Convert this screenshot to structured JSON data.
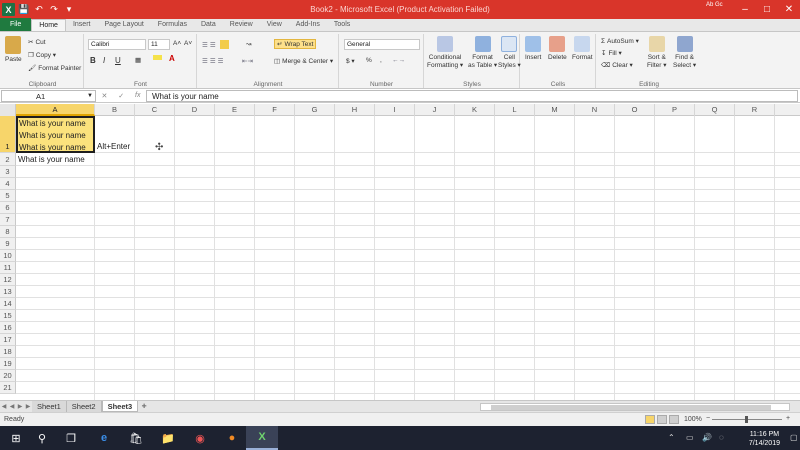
{
  "titlebar": {
    "title": "Book2 - Microsoft Excel (Product Activation Failed)",
    "account_text": "Ab Gc"
  },
  "ribbon_tabs": [
    "File",
    "Home",
    "Insert",
    "Page Layout",
    "Formulas",
    "Data",
    "Review",
    "View",
    "Add-Ins",
    "Tools"
  ],
  "active_tab": "Home",
  "clipboard": {
    "paste": "Paste",
    "cut": "Cut",
    "copy": "Copy ▾",
    "format_painter": "Format Painter",
    "label": "Clipboard"
  },
  "font": {
    "name": "Calibri",
    "size": "11",
    "bold": "B",
    "italic": "I",
    "underline": "U",
    "label": "Font",
    "grow": "A˄",
    "shrink": "A˅"
  },
  "alignment": {
    "wrap_text": "Wrap Text",
    "merge_center": "Merge & Center ▾",
    "label": "Alignment"
  },
  "number": {
    "format": "General",
    "currency": "$ ▾",
    "percent": "%",
    "comma": ",",
    "label": "Number"
  },
  "styles": {
    "conditional": "Conditional\nFormatting ▾",
    "format_table": "Format\nas Table ▾",
    "cell_styles": "Cell\nStyles ▾",
    "label": "Styles"
  },
  "cells": {
    "insert": "Insert",
    "delete": "Delete",
    "format": "Format",
    "label": "Cells"
  },
  "editing": {
    "autosum": "AutoSum ▾",
    "fill": "Fill ▾",
    "clear": "Clear ▾",
    "sort_filter": "Sort &\nFilter ▾",
    "find_select": "Find &\nSelect ▾",
    "label": "Editing"
  },
  "formula_bar": {
    "name_box": "A1",
    "formula": "What is your name"
  },
  "columns": [
    "A",
    "B",
    "C",
    "D",
    "E",
    "F",
    "G",
    "H",
    "I",
    "J",
    "K",
    "L",
    "M",
    "N",
    "O",
    "P",
    "Q",
    "R"
  ],
  "rows": [
    "1",
    "2",
    "3",
    "4",
    "5",
    "6",
    "7",
    "8",
    "9",
    "10",
    "11",
    "12",
    "13",
    "14",
    "15",
    "16",
    "17",
    "18",
    "19",
    "20",
    "21"
  ],
  "cells_content": {
    "A1_lines": [
      "What is your name",
      "What is your name",
      "What is your name"
    ],
    "B1": "Alt+Enter",
    "A2": "What is your name"
  },
  "sheets": [
    "Sheet1",
    "Sheet2",
    "Sheet3"
  ],
  "active_sheet": "Sheet3",
  "status": {
    "ready": "Ready",
    "zoom": "100%",
    "zoom_out": "−",
    "zoom_in": "+"
  },
  "taskbar": {
    "time": "11:16 PM",
    "date": "7/14/2019"
  }
}
